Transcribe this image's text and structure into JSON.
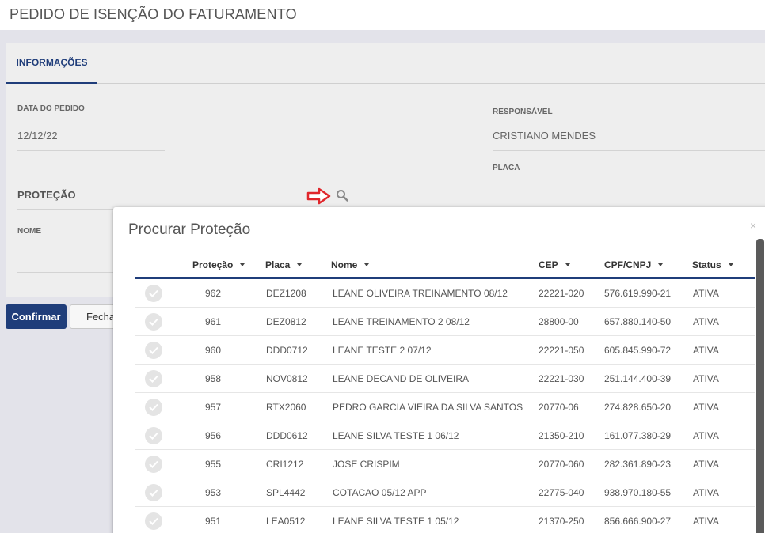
{
  "page": {
    "title": "PEDIDO DE ISENÇÃO DO FATURAMENTO"
  },
  "tabs": [
    {
      "label": "INFORMAÇÕES"
    }
  ],
  "form": {
    "data_pedido_label": "DATA DO PEDIDO",
    "data_pedido_value": "12/12/22",
    "responsavel_label": "RESPONSÁVEL",
    "responsavel_value": "CRISTIANO MENDES",
    "placa_label": "PLACA",
    "protecao_title": "PROTEÇÃO",
    "nome_label": "NOME"
  },
  "buttons": {
    "confirm": "Confirmar",
    "close": "Fechar"
  },
  "modal": {
    "title": "Procurar Proteção",
    "close_symbol": "×",
    "columns": [
      "Proteção",
      "Placa",
      "Nome",
      "CEP",
      "CPF/CNPJ",
      "Status"
    ],
    "rows": [
      {
        "protecao": "962",
        "placa": "DEZ1208",
        "nome": "LEANE OLIVEIRA TREINAMENTO 08/12",
        "cep": "22221-020",
        "cpf": "576.619.990-21",
        "status": "ATIVA"
      },
      {
        "protecao": "961",
        "placa": "DEZ0812",
        "nome": "LEANE TREINAMENTO 2 08/12",
        "cep": "28800-00",
        "cpf": "657.880.140-50",
        "status": "ATIVA"
      },
      {
        "protecao": "960",
        "placa": "DDD0712",
        "nome": "LEANE TESTE 2 07/12",
        "cep": "22221-050",
        "cpf": "605.845.990-72",
        "status": "ATIVA"
      },
      {
        "protecao": "958",
        "placa": "NOV0812",
        "nome": "LEANE DECAND DE OLIVEIRA",
        "cep": "22221-030",
        "cpf": "251.144.400-39",
        "status": "ATIVA"
      },
      {
        "protecao": "957",
        "placa": "RTX2060",
        "nome": "PEDRO GARCIA VIEIRA DA SILVA SANTOS",
        "cep": "20770-06",
        "cpf": "274.828.650-20",
        "status": "ATIVA"
      },
      {
        "protecao": "956",
        "placa": "DDD0612",
        "nome": "LEANE SILVA TESTE 1 06/12",
        "cep": "21350-210",
        "cpf": "161.077.380-29",
        "status": "ATIVA"
      },
      {
        "protecao": "955",
        "placa": "CRI1212",
        "nome": "JOSE CRISPIM",
        "cep": "20770-060",
        "cpf": "282.361.890-23",
        "status": "ATIVA"
      },
      {
        "protecao": "953",
        "placa": "SPL4442",
        "nome": "COTACAO 05/12 APP",
        "cep": "22775-040",
        "cpf": "938.970.180-55",
        "status": "ATIVA"
      },
      {
        "protecao": "951",
        "placa": "LEA0512",
        "nome": "LEANE SILVA TESTE 1 05/12",
        "cep": "21370-250",
        "cpf": "856.666.900-27",
        "status": "ATIVA"
      }
    ]
  },
  "colors": {
    "accent": "#1f3d7a",
    "arrow": "#e0262b"
  }
}
